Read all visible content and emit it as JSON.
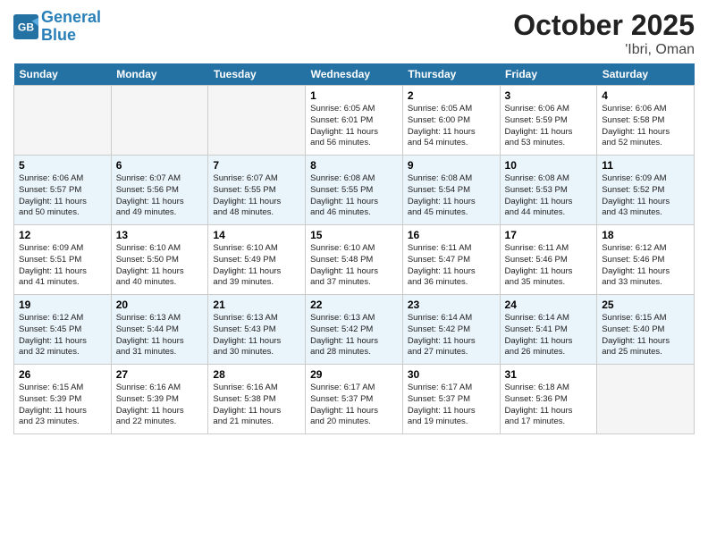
{
  "header": {
    "logo_line1": "General",
    "logo_line2": "Blue",
    "month": "October 2025",
    "location": "'Ibri, Oman"
  },
  "weekdays": [
    "Sunday",
    "Monday",
    "Tuesday",
    "Wednesday",
    "Thursday",
    "Friday",
    "Saturday"
  ],
  "weeks": [
    [
      {
        "day": "",
        "info": ""
      },
      {
        "day": "",
        "info": ""
      },
      {
        "day": "",
        "info": ""
      },
      {
        "day": "1",
        "info": "Sunrise: 6:05 AM\nSunset: 6:01 PM\nDaylight: 11 hours\nand 56 minutes."
      },
      {
        "day": "2",
        "info": "Sunrise: 6:05 AM\nSunset: 6:00 PM\nDaylight: 11 hours\nand 54 minutes."
      },
      {
        "day": "3",
        "info": "Sunrise: 6:06 AM\nSunset: 5:59 PM\nDaylight: 11 hours\nand 53 minutes."
      },
      {
        "day": "4",
        "info": "Sunrise: 6:06 AM\nSunset: 5:58 PM\nDaylight: 11 hours\nand 52 minutes."
      }
    ],
    [
      {
        "day": "5",
        "info": "Sunrise: 6:06 AM\nSunset: 5:57 PM\nDaylight: 11 hours\nand 50 minutes."
      },
      {
        "day": "6",
        "info": "Sunrise: 6:07 AM\nSunset: 5:56 PM\nDaylight: 11 hours\nand 49 minutes."
      },
      {
        "day": "7",
        "info": "Sunrise: 6:07 AM\nSunset: 5:55 PM\nDaylight: 11 hours\nand 48 minutes."
      },
      {
        "day": "8",
        "info": "Sunrise: 6:08 AM\nSunset: 5:55 PM\nDaylight: 11 hours\nand 46 minutes."
      },
      {
        "day": "9",
        "info": "Sunrise: 6:08 AM\nSunset: 5:54 PM\nDaylight: 11 hours\nand 45 minutes."
      },
      {
        "day": "10",
        "info": "Sunrise: 6:08 AM\nSunset: 5:53 PM\nDaylight: 11 hours\nand 44 minutes."
      },
      {
        "day": "11",
        "info": "Sunrise: 6:09 AM\nSunset: 5:52 PM\nDaylight: 11 hours\nand 43 minutes."
      }
    ],
    [
      {
        "day": "12",
        "info": "Sunrise: 6:09 AM\nSunset: 5:51 PM\nDaylight: 11 hours\nand 41 minutes."
      },
      {
        "day": "13",
        "info": "Sunrise: 6:10 AM\nSunset: 5:50 PM\nDaylight: 11 hours\nand 40 minutes."
      },
      {
        "day": "14",
        "info": "Sunrise: 6:10 AM\nSunset: 5:49 PM\nDaylight: 11 hours\nand 39 minutes."
      },
      {
        "day": "15",
        "info": "Sunrise: 6:10 AM\nSunset: 5:48 PM\nDaylight: 11 hours\nand 37 minutes."
      },
      {
        "day": "16",
        "info": "Sunrise: 6:11 AM\nSunset: 5:47 PM\nDaylight: 11 hours\nand 36 minutes."
      },
      {
        "day": "17",
        "info": "Sunrise: 6:11 AM\nSunset: 5:46 PM\nDaylight: 11 hours\nand 35 minutes."
      },
      {
        "day": "18",
        "info": "Sunrise: 6:12 AM\nSunset: 5:46 PM\nDaylight: 11 hours\nand 33 minutes."
      }
    ],
    [
      {
        "day": "19",
        "info": "Sunrise: 6:12 AM\nSunset: 5:45 PM\nDaylight: 11 hours\nand 32 minutes."
      },
      {
        "day": "20",
        "info": "Sunrise: 6:13 AM\nSunset: 5:44 PM\nDaylight: 11 hours\nand 31 minutes."
      },
      {
        "day": "21",
        "info": "Sunrise: 6:13 AM\nSunset: 5:43 PM\nDaylight: 11 hours\nand 30 minutes."
      },
      {
        "day": "22",
        "info": "Sunrise: 6:13 AM\nSunset: 5:42 PM\nDaylight: 11 hours\nand 28 minutes."
      },
      {
        "day": "23",
        "info": "Sunrise: 6:14 AM\nSunset: 5:42 PM\nDaylight: 11 hours\nand 27 minutes."
      },
      {
        "day": "24",
        "info": "Sunrise: 6:14 AM\nSunset: 5:41 PM\nDaylight: 11 hours\nand 26 minutes."
      },
      {
        "day": "25",
        "info": "Sunrise: 6:15 AM\nSunset: 5:40 PM\nDaylight: 11 hours\nand 25 minutes."
      }
    ],
    [
      {
        "day": "26",
        "info": "Sunrise: 6:15 AM\nSunset: 5:39 PM\nDaylight: 11 hours\nand 23 minutes."
      },
      {
        "day": "27",
        "info": "Sunrise: 6:16 AM\nSunset: 5:39 PM\nDaylight: 11 hours\nand 22 minutes."
      },
      {
        "day": "28",
        "info": "Sunrise: 6:16 AM\nSunset: 5:38 PM\nDaylight: 11 hours\nand 21 minutes."
      },
      {
        "day": "29",
        "info": "Sunrise: 6:17 AM\nSunset: 5:37 PM\nDaylight: 11 hours\nand 20 minutes."
      },
      {
        "day": "30",
        "info": "Sunrise: 6:17 AM\nSunset: 5:37 PM\nDaylight: 11 hours\nand 19 minutes."
      },
      {
        "day": "31",
        "info": "Sunrise: 6:18 AM\nSunset: 5:36 PM\nDaylight: 11 hours\nand 17 minutes."
      },
      {
        "day": "",
        "info": ""
      }
    ]
  ]
}
